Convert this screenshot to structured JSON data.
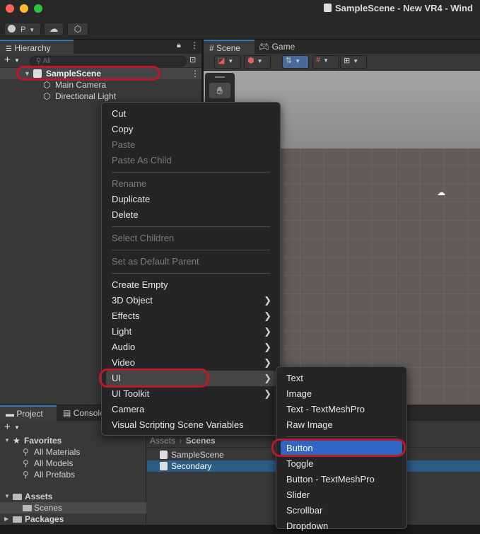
{
  "window": {
    "title": "SampleScene - New VR4 - Wind"
  },
  "toolbar": {
    "account_label": "P"
  },
  "hierarchy": {
    "tab": "Hierarchy",
    "search_placeholder": "All",
    "root": "SampleScene",
    "children": [
      "Main Camera",
      "Directional Light"
    ]
  },
  "scene_view": {
    "tabs": [
      "Scene",
      "Game"
    ]
  },
  "project": {
    "tabs": [
      "Project",
      "Console"
    ],
    "tree": {
      "favorites": "Favorites",
      "fav_items": [
        "All Materials",
        "All Models",
        "All Prefabs"
      ],
      "assets": "Assets",
      "assets_items": [
        "Scenes"
      ],
      "packages": "Packages"
    },
    "breadcrumb": [
      "Assets",
      "Scenes"
    ],
    "files": [
      "SampleScene",
      "Secondary"
    ]
  },
  "context_menu": {
    "items": [
      "Cut",
      "Copy",
      "Paste",
      "Paste As Child",
      "Rename",
      "Duplicate",
      "Delete",
      "Select Children",
      "Set as Default Parent",
      "Create Empty",
      "3D Object",
      "Effects",
      "Light",
      "Audio",
      "Video",
      "UI",
      "UI Toolkit",
      "Camera",
      "Visual Scripting Scene Variables"
    ]
  },
  "ui_submenu": {
    "items": [
      "Text",
      "Image",
      "Text - TextMeshPro",
      "Raw Image",
      "Button",
      "Toggle",
      "Button - TextMeshPro",
      "Slider",
      "Scrollbar",
      "Dropdown"
    ]
  }
}
